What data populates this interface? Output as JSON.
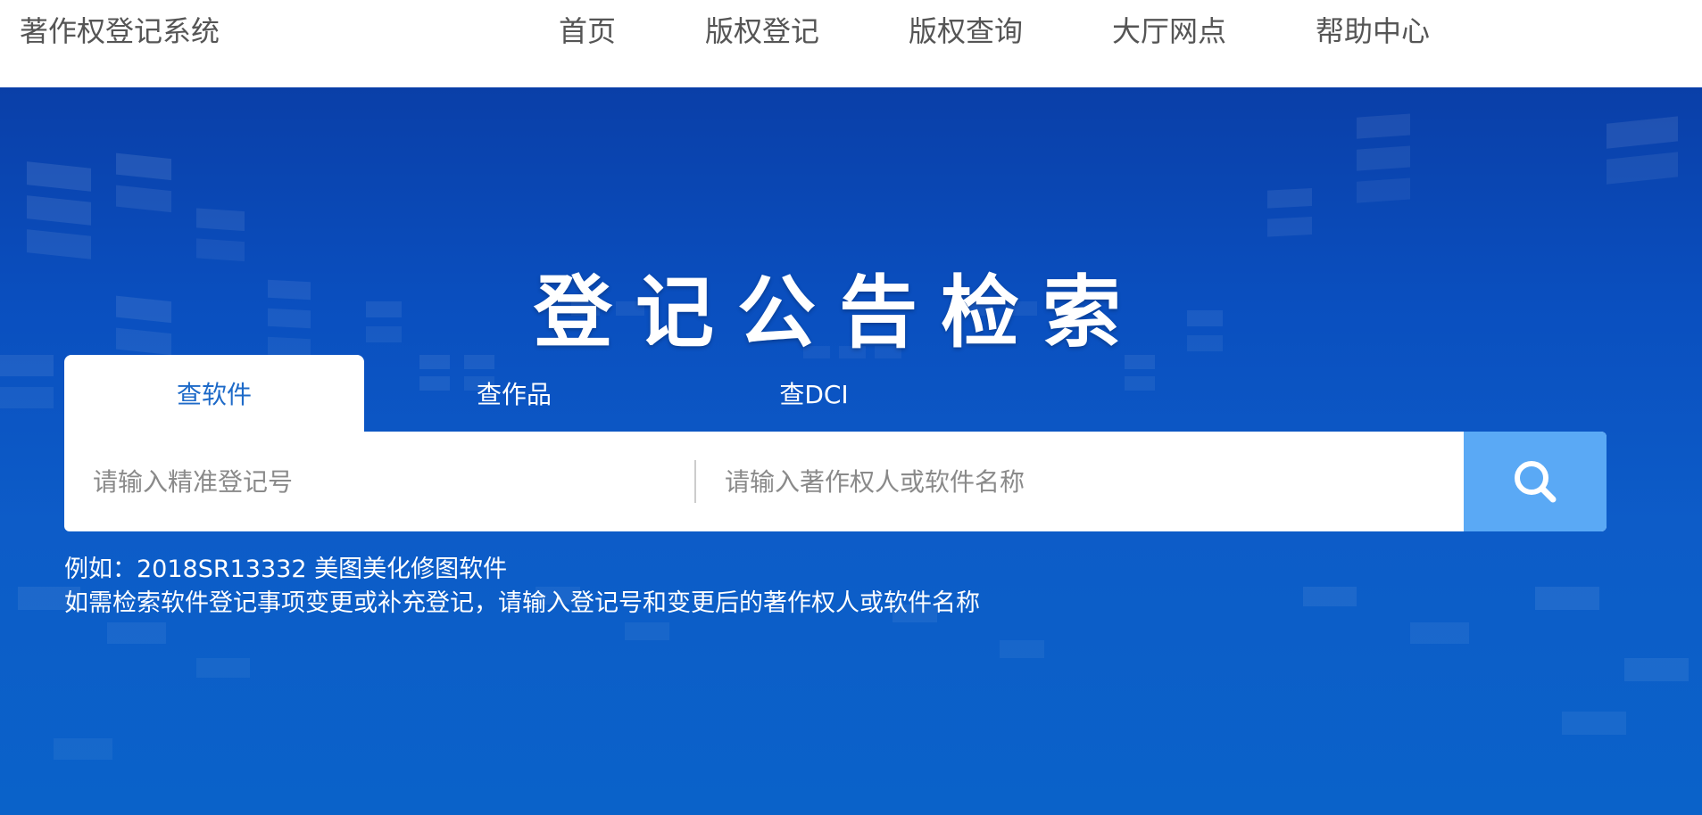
{
  "header": {
    "logo_text": "著作权登记系统",
    "nav": [
      {
        "label": "首页"
      },
      {
        "label": "版权登记"
      },
      {
        "label": "版权查询"
      },
      {
        "label": "大厅网点"
      },
      {
        "label": "帮助中心"
      }
    ]
  },
  "hero": {
    "title": "登记公告检索"
  },
  "tabs": [
    {
      "label": "查软件",
      "active": true
    },
    {
      "label": "查作品",
      "active": false
    },
    {
      "label": "查DCI",
      "active": false
    }
  ],
  "search": {
    "reg_placeholder": "请输入精准登记号",
    "name_placeholder": "请输入著作权人或软件名称",
    "button_icon": "search-icon"
  },
  "hints": {
    "example": "例如：2018SR13332 美图美化修图软件",
    "note": "如需检索软件登记事项变更或补充登记，请输入登记号和变更后的著作权人或软件名称"
  },
  "colors": {
    "hero_blue": "#0a4fbf",
    "active_tab_text": "#1e6ac8",
    "search_button": "#5aa9f5",
    "nav_text": "#555555"
  }
}
